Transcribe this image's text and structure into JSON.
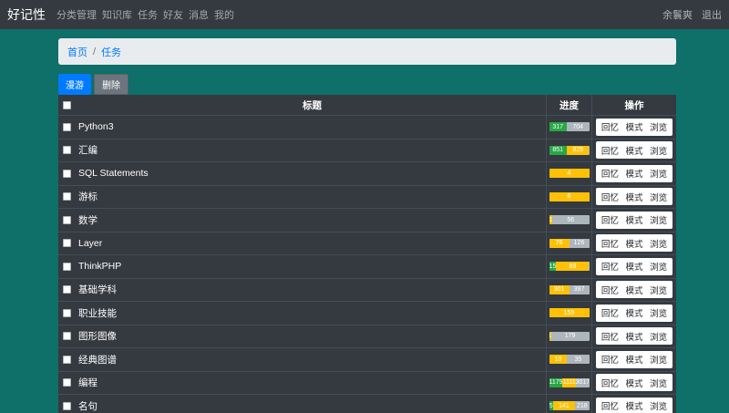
{
  "navbar": {
    "brand": "好记性",
    "links": [
      "分类管理",
      "知识库",
      "任务",
      "好友",
      "消息",
      "我的"
    ],
    "user": "余鬟爽",
    "logout": "退出"
  },
  "breadcrumb": {
    "home": "首页",
    "current": "任务"
  },
  "buttons": {
    "roam": "漫游",
    "delete": "删除"
  },
  "table": {
    "headers": {
      "title": "标题",
      "progress": "进度",
      "actions": "操作"
    },
    "actions": [
      "回忆",
      "模式",
      "浏览"
    ],
    "rows": [
      {
        "title": "Python3",
        "progress": [
          {
            "c": "g",
            "label": "317",
            "f": 0.44
          },
          {
            "c": "s",
            "label": "704",
            "f": 0.56
          }
        ]
      },
      {
        "title": "汇编",
        "progress": [
          {
            "c": "g",
            "label": "851",
            "f": 0.44
          },
          {
            "c": "y",
            "label": "829",
            "f": 0.56
          }
        ]
      },
      {
        "title": "SQL Statements",
        "progress": [
          {
            "c": "y",
            "label": "4",
            "f": 1.0
          }
        ]
      },
      {
        "title": "游标",
        "progress": [
          {
            "c": "y",
            "label": "6",
            "f": 1.0
          }
        ]
      },
      {
        "title": "数学",
        "progress": [
          {
            "c": "y",
            "label": "1",
            "f": 0.08
          },
          {
            "c": "s",
            "label": "56",
            "f": 0.92
          }
        ]
      },
      {
        "title": "Layer",
        "progress": [
          {
            "c": "y",
            "label": "76",
            "f": 0.5
          },
          {
            "c": "s",
            "label": "126",
            "f": 0.5
          }
        ]
      },
      {
        "title": "ThinkPHP",
        "progress": [
          {
            "c": "g",
            "label": "15",
            "f": 0.18
          },
          {
            "c": "y",
            "label": "89",
            "f": 0.82
          }
        ]
      },
      {
        "title": "基础学科",
        "progress": [
          {
            "c": "y",
            "label": "301",
            "f": 0.5
          },
          {
            "c": "s",
            "label": "397",
            "f": 0.5
          }
        ]
      },
      {
        "title": "职业技能",
        "progress": [
          {
            "c": "y",
            "label": "159",
            "f": 1.0
          }
        ]
      },
      {
        "title": "图形图像",
        "progress": [
          {
            "c": "y",
            "label": "1",
            "f": 0.05
          },
          {
            "c": "s",
            "label": "179",
            "f": 0.95
          }
        ]
      },
      {
        "title": "经典图谱",
        "progress": [
          {
            "c": "y",
            "label": "10",
            "f": 0.45
          },
          {
            "c": "s",
            "label": "35",
            "f": 0.55
          }
        ]
      },
      {
        "title": "编程",
        "progress": [
          {
            "c": "g",
            "label": "1179",
            "f": 0.34
          },
          {
            "c": "y",
            "label": "1111",
            "f": 0.33
          },
          {
            "c": "s",
            "label": "3017",
            "f": 0.33
          }
        ]
      },
      {
        "title": "名句",
        "progress": [
          {
            "c": "g",
            "label": "5",
            "f": 0.1
          },
          {
            "c": "y",
            "label": "141",
            "f": 0.55
          },
          {
            "c": "s",
            "label": "218",
            "f": 0.35
          }
        ]
      }
    ]
  }
}
